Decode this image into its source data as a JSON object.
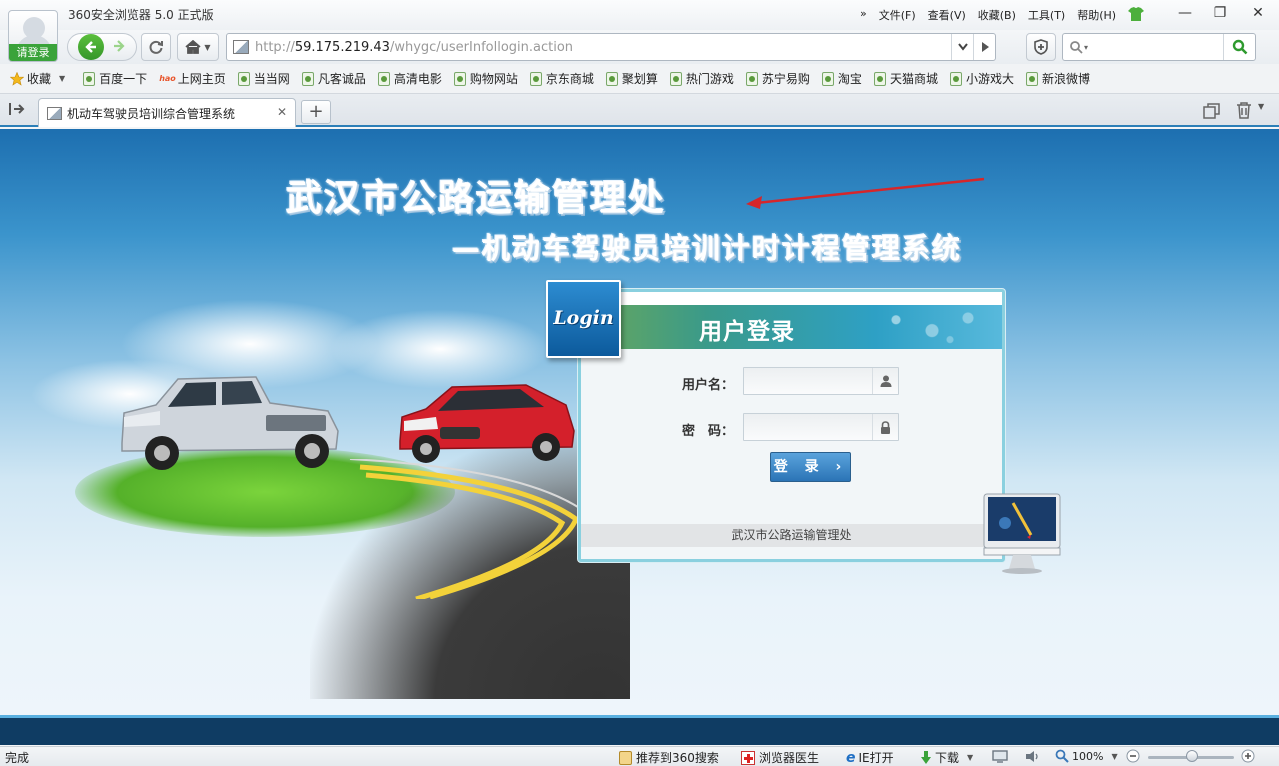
{
  "window": {
    "app_title": "360安全浏览器 5.0 正式版",
    "login_label": "请登录",
    "menus": [
      "文件(F)",
      "查看(V)",
      "收藏(B)",
      "工具(T)",
      "帮助(H)"
    ],
    "menu_more": "»",
    "controls": {
      "minimize": "—",
      "restore": "❐",
      "close": "✕"
    }
  },
  "address_bar": {
    "scheme": "http://",
    "host": "59.175.219.43",
    "path": "/whygc/userInfollogin.action"
  },
  "search": {
    "placeholder": ""
  },
  "bookmarks": {
    "favorites_label": "收藏",
    "items": [
      "百度一下",
      "上网主页",
      "当当网",
      "凡客诚品",
      "高清电影",
      "购物网站",
      "京东商城",
      "聚划算",
      "热门游戏",
      "苏宁易购",
      "淘宝",
      "天猫商城",
      "小游戏大",
      "新浪微博"
    ]
  },
  "tab": {
    "title": "机动车驾驶员培训综合管理系统",
    "close": "✕",
    "new_tab": "+"
  },
  "page": {
    "headline": "武汉市公路运输管理处",
    "subheadline": "—机动车驾驶员培训计时计程管理系统",
    "login": {
      "badge": "Login",
      "title": "用户登录",
      "username_label": "用户名：",
      "password_label": "密　码：",
      "username_value": "",
      "password_value": "",
      "submit_label": "登 录 ›",
      "footer": "武汉市公路运输管理处"
    }
  },
  "status_bar": {
    "status": "完成",
    "recommend": "推荐到360搜索",
    "doctor": "浏览器医生",
    "ie_open": "IE打开",
    "download": "下载",
    "zoom": "100%"
  },
  "colors": {
    "accent_blue": "#2c7fb8",
    "login_green": "#3aa33a",
    "submit_blue": "#2b74b6",
    "footer_band": "#0f3c63"
  }
}
